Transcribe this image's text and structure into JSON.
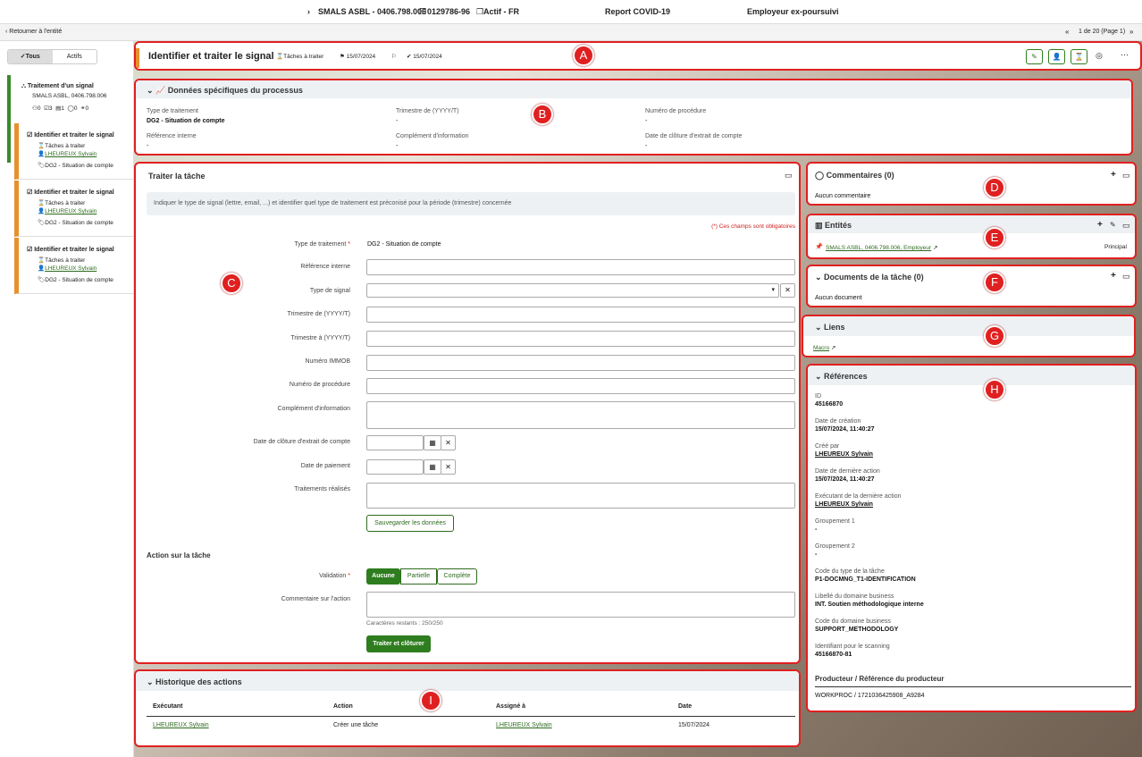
{
  "topbar": {
    "entity": "SMALS ASBL - 0406.798.006",
    "id": "0129786-96",
    "status": "Actif - FR",
    "report": "Report COVID-19",
    "employer": "Employeur ex-poursuivi"
  },
  "subbar": {
    "back": "Retourner à l'entité",
    "pager": "1 de 20 (Page 1)"
  },
  "sidebar": {
    "toggle_all": "Tous",
    "toggle_active": "Actifs",
    "process": {
      "title": "Traitement d'un signal",
      "subtitle": "SMALS ASBL, 0406.798.006",
      "counts": [
        "0",
        "3",
        "1",
        "0",
        "0"
      ]
    },
    "tasks": [
      {
        "title": "Identifier et traiter le signal",
        "status": "Tâches à traiter",
        "user": "LHEUREUX Sylvain",
        "tag": "DG2 - Situation de compte"
      },
      {
        "title": "Identifier et traiter le signal",
        "status": "Tâches à traiter",
        "user": "LHEUREUX Sylvain",
        "tag": "DG2 - Situation de compte"
      },
      {
        "title": "Identifier et traiter le signal",
        "status": "Tâches à traiter",
        "user": "LHEUREUX Sylvain",
        "tag": "DG2 - Situation de compte"
      }
    ]
  },
  "header": {
    "title": "Identifier et traiter le signal",
    "status": "Tâches à traiter",
    "date1": "15/07/2024",
    "date2": "15/07/2024"
  },
  "process_data": {
    "title": "Données spécifiques du processus",
    "fields": [
      {
        "label": "Type de traitement",
        "value": "DG2 - Situation de compte"
      },
      {
        "label": "Trimestre de (YYYY/T)",
        "value": "-"
      },
      {
        "label": "Numéro de procédure",
        "value": "-"
      },
      {
        "label": "Référence interne",
        "value": "-"
      },
      {
        "label": "Complément d'information",
        "value": "-"
      },
      {
        "label": "Date de clôture d'extrait de compte",
        "value": "-"
      }
    ]
  },
  "task_form": {
    "title": "Traiter la tâche",
    "info": "Indiquer le type de signal (lettre, email, ...) et identifier quel type de traitement est préconisé pour la période (trimestre) concernée",
    "required_note": "(*) Ces champs sont obligatoires",
    "type_label": "Type de traitement",
    "type_value": "DG2 - Situation de compte",
    "labels": [
      "Référence interne",
      "Type de signal",
      "Trimestre de (YYYY/T)",
      "Trimestre à (YYYY/T)",
      "Numéro IMMOB",
      "Numéro de procédure",
      "Complément d'information",
      "Date de clôture d'extrait de compte",
      "Date de paiement",
      "Traitements réalisés"
    ],
    "save": "Sauvegarder les données",
    "action_title": "Action sur la tâche",
    "validation_label": "Validation",
    "validation_options": [
      "Aucune",
      "Partielle",
      "Complète"
    ],
    "comment_label": "Commentaire sur l'action",
    "remaining": "Caractères restants : 250/250",
    "submit": "Traiter et clôturer"
  },
  "history": {
    "title": "Historique des actions",
    "columns": [
      "Exécutant",
      "Action",
      "Assigné à",
      "Date"
    ],
    "rows": [
      {
        "executor": "LHEUREUX Sylvain",
        "action": "Créer une tâche",
        "assignee": "LHEUREUX Sylvain",
        "date": "15/07/2024"
      }
    ]
  },
  "comments": {
    "title": "Commentaires (0)",
    "empty": "Aucun commentaire"
  },
  "entities": {
    "title": "Entités",
    "link": "SMALS ASBL, 0406.798.006, Employeur",
    "role": "Principal"
  },
  "documents": {
    "title": "Documents de la tâche (0)",
    "empty": "Aucun document"
  },
  "links": {
    "title": "Liens",
    "item": "Macro"
  },
  "references": {
    "title": "Références",
    "items": [
      {
        "label": "ID",
        "value": "45166870"
      },
      {
        "label": "Date de création",
        "value": "15/07/2024, 11:40:27"
      },
      {
        "label": "Créé par",
        "value": "LHEUREUX Sylvain"
      },
      {
        "label": "Date de dernière action",
        "value": "15/07/2024, 11:40:27"
      },
      {
        "label": "Exécutant de la dernière action",
        "value": "LHEUREUX Sylvain"
      },
      {
        "label": "Groupement 1",
        "value": "-"
      },
      {
        "label": "Groupement 2",
        "value": "-"
      },
      {
        "label": "Code du type de la tâche",
        "value": "P1-DOCMNG_T1-IDENTIFICATION"
      },
      {
        "label": "Libellé du domaine business",
        "value": "INT. Soutien méthodologique interne"
      },
      {
        "label": "Code du domaine business",
        "value": "SUPPORT_METHODOLOGY"
      },
      {
        "label": "Identifiant pour le scanning",
        "value": "45166870-81"
      }
    ],
    "producer_title": "Producteur / Référence du producteur",
    "producer_value": "WORKPROC / 1721036425908_A9284"
  },
  "markers": [
    "A",
    "B",
    "C",
    "D",
    "E",
    "F",
    "G",
    "H",
    "I"
  ]
}
